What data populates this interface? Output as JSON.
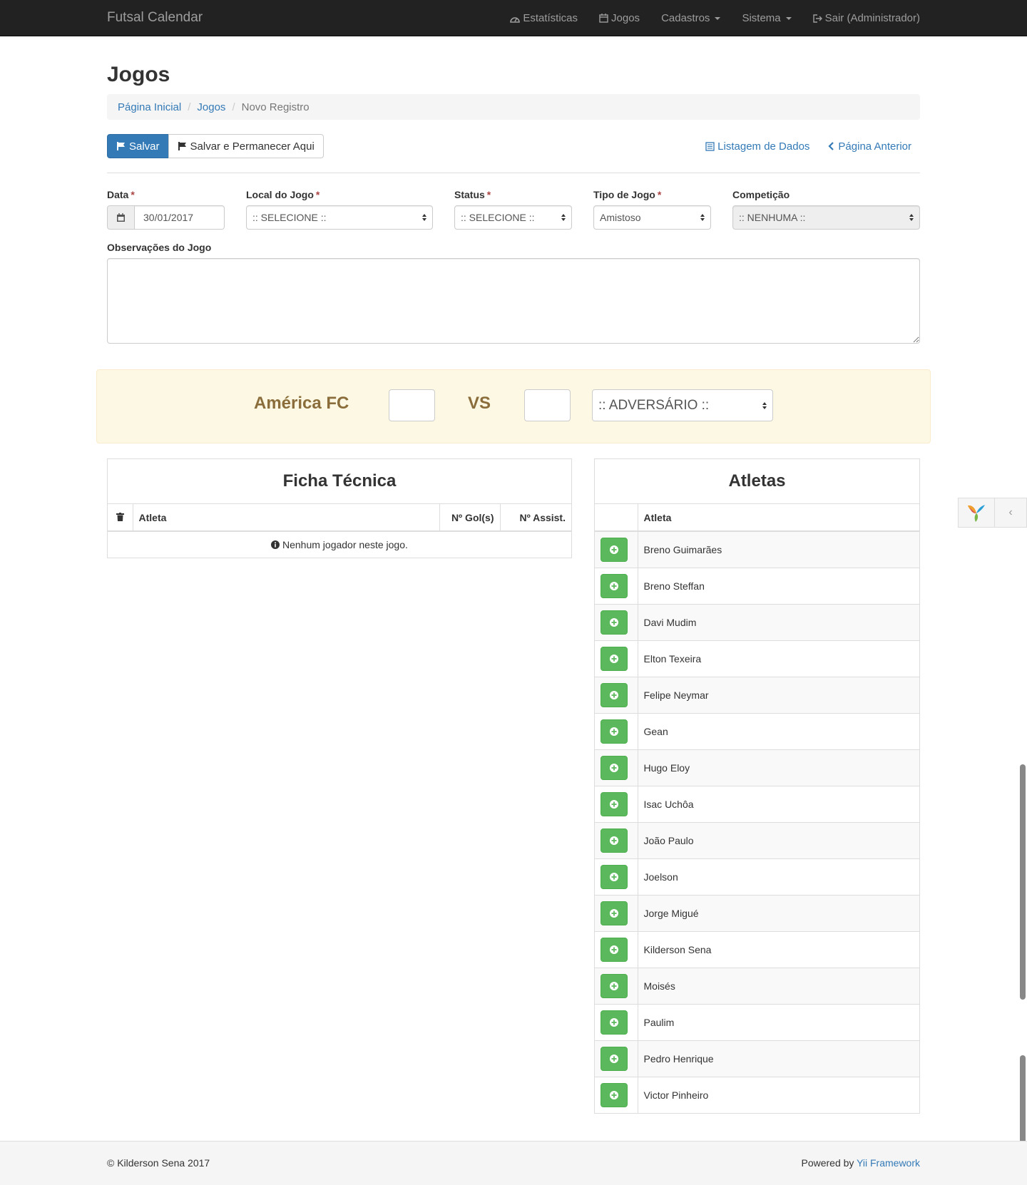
{
  "navbar": {
    "brand": "Futsal Calendar",
    "items": [
      {
        "label": "Estatísticas",
        "icon": "dashboard-icon"
      },
      {
        "label": "Jogos",
        "icon": "calendar-icon"
      },
      {
        "label": "Cadastros",
        "dropdown": true
      },
      {
        "label": "Sistema",
        "dropdown": true
      },
      {
        "label": "Sair (Administrador)",
        "icon": "logout-icon"
      }
    ]
  },
  "page": {
    "title": "Jogos"
  },
  "breadcrumb": {
    "home": "Página Inicial",
    "section": "Jogos",
    "current": "Novo Registro"
  },
  "toolbar": {
    "save_label": "Salvar",
    "save_stay_label": "Salvar e Permanecer Aqui",
    "list_label": "Listagem de Dados",
    "back_label": "Página Anterior"
  },
  "form": {
    "data_label": "Data",
    "data_value": "30/01/2017",
    "local_label": "Local do Jogo",
    "local_value": ":: SELECIONE ::",
    "status_label": "Status",
    "status_value": ":: SELECIONE ::",
    "tipo_label": "Tipo de Jogo",
    "tipo_value": "Amistoso",
    "competicao_label": "Competição",
    "competicao_value": ":: NENHUMA ::",
    "obs_label": "Observações do Jogo",
    "required_mark": "*"
  },
  "match": {
    "team": "América FC",
    "vs": "VS",
    "opponent_placeholder": ":: ADVERSÁRIO ::"
  },
  "ficha": {
    "title": "Ficha Técnica",
    "col_atleta": "Atleta",
    "col_gols": "Nº Gol(s)",
    "col_assist": "Nº Assist.",
    "empty": "Nenhum jogador neste jogo."
  },
  "atletas": {
    "title": "Atletas",
    "col_atleta": "Atleta",
    "list": [
      "Breno Guimarães",
      "Breno Steffan",
      "Davi Mudim",
      "Elton Texeira",
      "Felipe Neymar",
      "Gean",
      "Hugo Eloy",
      "Isac Uchôa",
      "João Paulo",
      "Joelson",
      "Jorge Migué",
      "Kilderson Sena",
      "Moisés",
      "Paulim",
      "Pedro Henrique",
      "Victor Pinheiro"
    ]
  },
  "footer": {
    "copyright": "© Kilderson Sena 2017",
    "powered": "Powered by",
    "framework": "Yii Framework"
  },
  "colors": {
    "primary": "#337ab7",
    "success": "#5cb85c",
    "warning_bg": "#fcf8e3",
    "warning_text": "#8a6d3b",
    "navbar": "#222222"
  }
}
